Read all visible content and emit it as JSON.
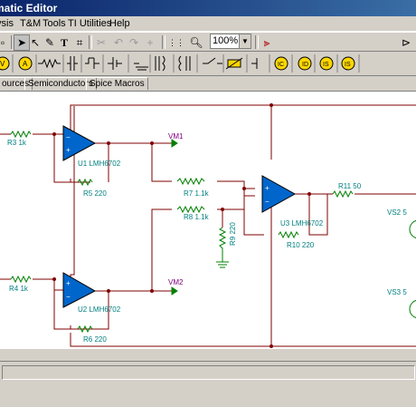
{
  "window": {
    "title": "matic Editor"
  },
  "menu": {
    "items": [
      "ysis",
      "T&M",
      "Tools",
      "TI Utilities",
      "Help"
    ]
  },
  "toolbar": {
    "zoom_value": "100%"
  },
  "tabs": [
    "ources",
    "Semiconductors",
    "Spice Macros"
  ],
  "schematic": {
    "labels": {
      "r3": "R3 1k",
      "u1": "U1 LMH6702",
      "r5": "R5 220",
      "vm1": "VM1",
      "r7": "R7 1.1k",
      "r8": "R8 1.1k",
      "r9": "R9 220",
      "u3": "U3 LMH6702",
      "r10": "R10 220",
      "r11": "R11 50",
      "vs2": "VS2 5",
      "vs3": "VS3 5",
      "r4": "R4 1k",
      "u2": "U2 LMH6702",
      "r6": "R6 220",
      "vm2": "VM2"
    },
    "colors": {
      "wire": "#800000",
      "component": "#008000",
      "label": "#008080",
      "meter_label": "#800080",
      "opamp_fill": "#0066cc"
    }
  }
}
